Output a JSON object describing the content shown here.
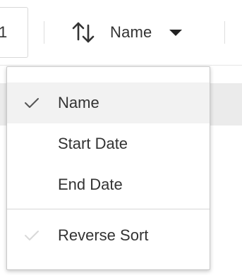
{
  "toolbar": {
    "page_value": "1",
    "sort_button_label": "Name"
  },
  "sort_menu": {
    "options": [
      {
        "label": "Name",
        "checked": true
      },
      {
        "label": "Start Date",
        "checked": false
      },
      {
        "label": "End Date",
        "checked": false
      }
    ],
    "reverse_sort": {
      "label": "Reverse Sort",
      "checked": false
    }
  },
  "colors": {
    "menu_background": "#ffffff",
    "selected_background": "#f2f2f2",
    "check_active": "#555555",
    "check_inactive": "#d9d9d9",
    "page_band": "#ebebeb"
  }
}
